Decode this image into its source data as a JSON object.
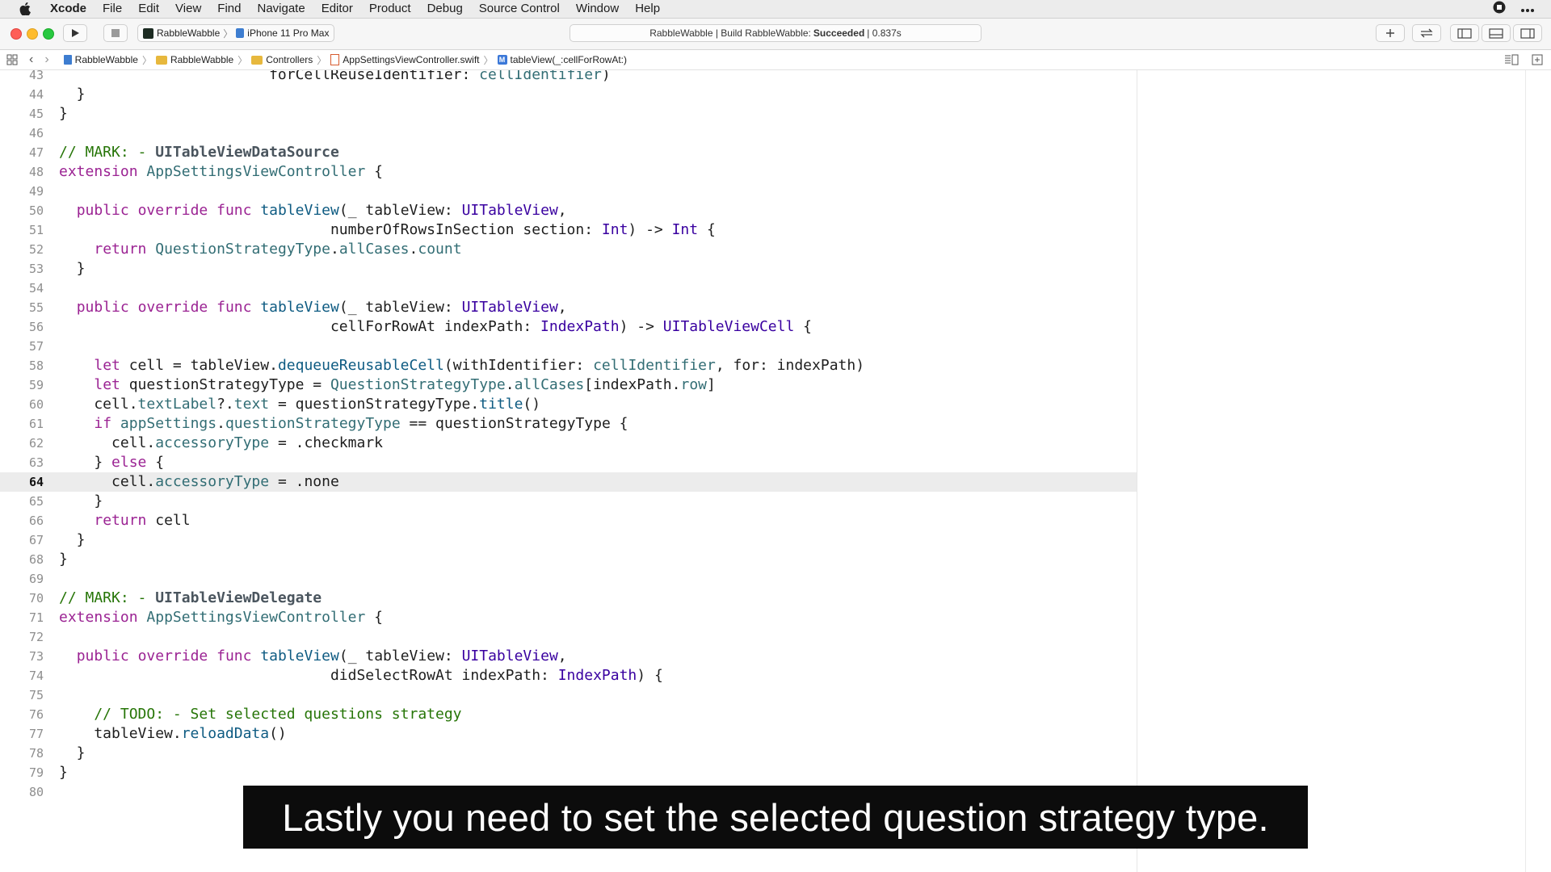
{
  "menubar": {
    "app": "Xcode",
    "items": [
      "File",
      "Edit",
      "View",
      "Find",
      "Navigate",
      "Editor",
      "Product",
      "Debug",
      "Source Control",
      "Window",
      "Help"
    ]
  },
  "toolbar": {
    "scheme_project": "RabbleWabble",
    "scheme_device": "iPhone 11 Pro Max",
    "activity_prefix": "RabbleWabble | Build RabbleWabble:",
    "activity_status": "Succeeded",
    "activity_time": "| 0.837s"
  },
  "jumpbar": {
    "crumbs": [
      "RabbleWabble",
      "RabbleWabble",
      "Controllers",
      "AppSettingsViewController.swift",
      "tableView(_:cellForRowAt:)"
    ]
  },
  "editor": {
    "current_line": 64,
    "lines": [
      {
        "n": "43",
        "text": "                        forCellReuseIdentifier: cellIdentifier)"
      },
      {
        "n": "44",
        "text": "  }"
      },
      {
        "n": "45",
        "text": "}"
      },
      {
        "n": "46",
        "text": ""
      },
      {
        "n": "47",
        "text": "// MARK: - UITableViewDataSource"
      },
      {
        "n": "48",
        "text": "extension AppSettingsViewController {"
      },
      {
        "n": "49",
        "text": ""
      },
      {
        "n": "50",
        "text": "  public override func tableView(_ tableView: UITableView,"
      },
      {
        "n": "51",
        "text": "                               numberOfRowsInSection section: Int) -> Int {"
      },
      {
        "n": "52",
        "text": "    return QuestionStrategyType.allCases.count"
      },
      {
        "n": "53",
        "text": "  }"
      },
      {
        "n": "54",
        "text": ""
      },
      {
        "n": "55",
        "text": "  public override func tableView(_ tableView: UITableView,"
      },
      {
        "n": "56",
        "text": "                               cellForRowAt indexPath: IndexPath) -> UITableViewCell {"
      },
      {
        "n": "57",
        "text": ""
      },
      {
        "n": "58",
        "text": "    let cell = tableView.dequeueReusableCell(withIdentifier: cellIdentifier, for: indexPath)"
      },
      {
        "n": "59",
        "text": "    let questionStrategyType = QuestionStrategyType.allCases[indexPath.row]"
      },
      {
        "n": "60",
        "text": "    cell.textLabel?.text = questionStrategyType.title()"
      },
      {
        "n": "61",
        "text": "    if appSettings.questionStrategyType == questionStrategyType {"
      },
      {
        "n": "62",
        "text": "      cell.accessoryType = .checkmark"
      },
      {
        "n": "63",
        "text": "    } else {"
      },
      {
        "n": "64",
        "text": "      cell.accessoryType = .none"
      },
      {
        "n": "65",
        "text": "    }"
      },
      {
        "n": "66",
        "text": "    return cell"
      },
      {
        "n": "67",
        "text": "  }"
      },
      {
        "n": "68",
        "text": "}"
      },
      {
        "n": "69",
        "text": ""
      },
      {
        "n": "70",
        "text": "// MARK: - UITableViewDelegate"
      },
      {
        "n": "71",
        "text": "extension AppSettingsViewController {"
      },
      {
        "n": "72",
        "text": ""
      },
      {
        "n": "73",
        "text": "  public override func tableView(_ tableView: UITableView,"
      },
      {
        "n": "74",
        "text": "                               didSelectRowAt indexPath: IndexPath) {"
      },
      {
        "n": "75",
        "text": ""
      },
      {
        "n": "76",
        "text": "    // TODO: - Set selected questions strategy"
      },
      {
        "n": "77",
        "text": "    tableView.reloadData()"
      },
      {
        "n": "78",
        "text": "  }"
      },
      {
        "n": "79",
        "text": "}"
      },
      {
        "n": "80",
        "text": ""
      }
    ]
  },
  "caption": "Lastly you need to set the selected question strategy type.",
  "colors": {
    "keyword": "#9b2393",
    "type": "#3900a0",
    "function": "#0e5b82",
    "property": "#326d74",
    "comment": "#267507"
  }
}
